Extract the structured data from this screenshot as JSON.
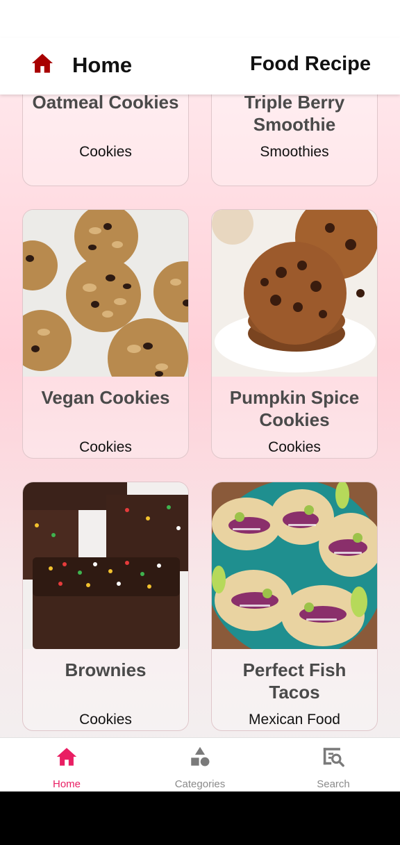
{
  "appbar": {
    "title": "Home",
    "right_title": "Food Recipe",
    "accent": "#a80000"
  },
  "recipes": [
    {
      "name": "Oatmeal Cookies",
      "category": "Cookies",
      "image": "oatmeal-cookies"
    },
    {
      "name": "Triple Berry Smoothie",
      "category": "Smoothies",
      "image": "berry-smoothie"
    },
    {
      "name": "Vegan Cookies",
      "category": "Cookies",
      "image": "vegan-cookies"
    },
    {
      "name": "Pumpkin Spice Cookies",
      "category": "Cookies",
      "image": "chocolate-chip-cookies"
    },
    {
      "name": "Brownies",
      "category": "Cookies",
      "image": "brownies-with-sprinkles"
    },
    {
      "name": "Perfect Fish Tacos",
      "category": "Mexican Food",
      "image": "fish-tacos"
    }
  ],
  "bottom_nav": {
    "active_color": "#e91e63",
    "items": [
      {
        "label": "Home",
        "icon": "home-icon",
        "active": true
      },
      {
        "label": "Categories",
        "icon": "categories-icon",
        "active": false
      },
      {
        "label": "Search",
        "icon": "search-icon",
        "active": false
      }
    ]
  }
}
